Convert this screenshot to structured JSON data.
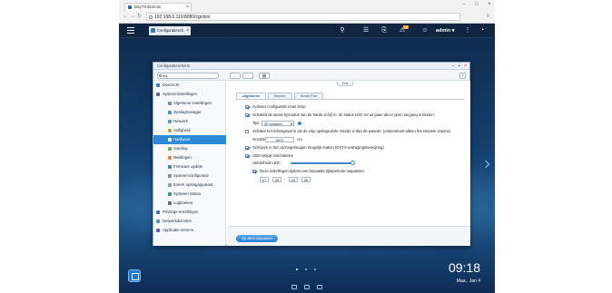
{
  "browser": {
    "tab_title": "BayTS453mini",
    "url": "192.168.0.119:8080/cgi-bin/",
    "window_controls": [
      "–",
      "□",
      "×"
    ]
  },
  "qts": {
    "app_tab_label": "Configuratiesch.",
    "user_label": "admin ▾",
    "notification_badge": "10",
    "clock_time": "09:18",
    "clock_date": "Maa., Jan 4"
  },
  "window": {
    "title": "Configuratiescherm",
    "search_value": "led",
    "help_label": "?"
  },
  "sidebar": {
    "items": [
      {
        "label": "Overzicht"
      },
      {
        "label": "Systeeminstellingen"
      },
      {
        "label": "Algemene instellingen"
      },
      {
        "label": "Opslagmanager"
      },
      {
        "label": "Netwerk"
      },
      {
        "label": "Veiligheid"
      },
      {
        "label": "Hardware"
      },
      {
        "label": "Voeding"
      },
      {
        "label": "Meldingen"
      },
      {
        "label": "Firmware update"
      },
      {
        "label": "Systeemconfiguratie"
      },
      {
        "label": "Extern opslagapparaat"
      },
      {
        "label": "Systeem Status"
      },
      {
        "label": "Logboeken"
      },
      {
        "label": "Privilege-instellingen"
      },
      {
        "label": "Netwerkdiensten"
      },
      {
        "label": "Applicatie-servers"
      }
    ]
  },
  "main": {
    "hint_tab": "Text",
    "tabs": [
      {
        "label": "Algemeen"
      },
      {
        "label": "Buzzer"
      },
      {
        "label": "Smart Fan"
      }
    ],
    "settings": {
      "reset_switch": "Activeer configuratie reset knop",
      "standby_mode": "Schakelt de stand-bymodus van de harde schijf in; de status LED zal uit gaan als er geen toegang is binnen:",
      "time_label": "Tijd:",
      "time_value": "30 minuten",
      "low_space_alert": "Schakel het lichtsignaal in als de vrije opslagruimte minder is dan de waarde: (ondersteunt alleen het simpele volume)",
      "size_label": "Grootte:",
      "size_value": "3072",
      "size_unit": "MB",
      "write_cache": "Schrijven in het cachegeheugen mogelijk maken (EXT4-vertragingstoewijzing)",
      "led_enable": "LED-lampje inschakelen",
      "brightness_label": "Helderheid LED:",
      "schedule": "Deze instellingen tijdens een bepaalde tijdsperiode toepassen",
      "schedule_from_h": "07",
      "schedule_from_m": "00",
      "schedule_to_h": "19",
      "schedule_to_m": "00"
    },
    "apply_label": "Op alles toepassen"
  }
}
